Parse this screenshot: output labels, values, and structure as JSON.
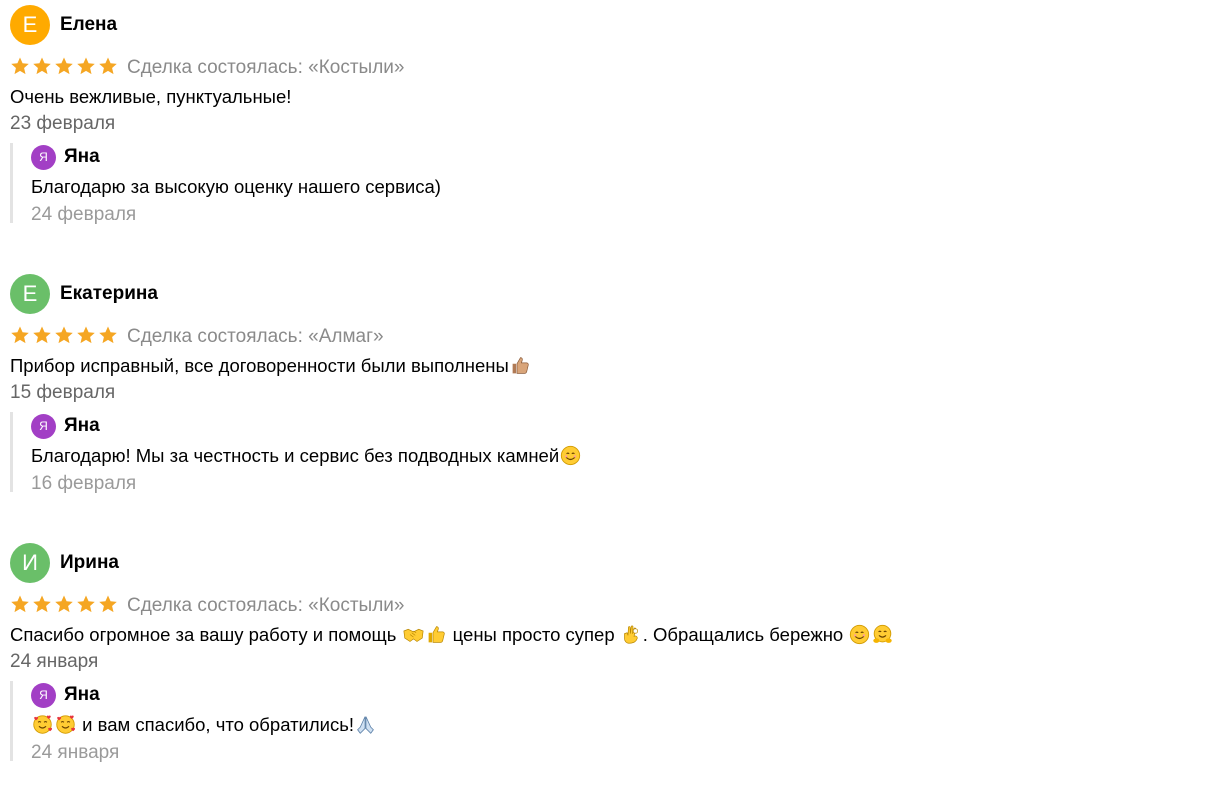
{
  "colors": {
    "star": "#f5a623",
    "avatar_orange": "#ffaa00",
    "avatar_green": "#6abf69",
    "reply_avatar": "#a23fc5"
  },
  "reviews": [
    {
      "author": "Елена",
      "initial": "Е",
      "rating": 5,
      "deal": "Сделка состоялась: «Костыли»",
      "text": "Очень вежливые, пунктуальные!",
      "date": "23 февраля",
      "reply": {
        "author": "Яна",
        "initial": "Я",
        "text": "Благодарю за высокую оценку нашего сервиса)",
        "date": "24 февраля"
      }
    },
    {
      "author": "Екатерина",
      "initial": "Е",
      "rating": 5,
      "deal": "Сделка состоялась: «Алмаг»",
      "text": "Прибор исправный, все договоренности были выполнены",
      "text_emoji": [
        "thumbs-up-emoji"
      ],
      "date": "15 февраля",
      "reply": {
        "author": "Яна",
        "initial": "Я",
        "text": "Благодарю! Мы за честность и сервис без подводных камней",
        "text_emoji": [
          "smiling-face-emoji"
        ],
        "date": "16 февраля"
      }
    },
    {
      "author": "Ирина",
      "initial": "И",
      "rating": 5,
      "deal": "Сделка состоялась: «Костыли»",
      "text_part1": "Спасибо огромное за вашу работу и помощь",
      "text_part2": "цены просто супер",
      "text_part3": ". Обращались бережно",
      "text_emoji": [
        "handshake-emoji",
        "thumbs-up-emoji",
        "ok-hand-emoji",
        "smiling-face-emoji",
        "hugging-face-emoji"
      ],
      "date": "24 января",
      "reply": {
        "author": "Яна",
        "initial": "Я",
        "text": "и вам спасибо, что обратились!",
        "text_emoji": [
          "smiling-face-with-hearts-emoji",
          "smiling-face-with-hearts-emoji",
          "folded-hands-emoji"
        ],
        "date": "24 января"
      }
    }
  ]
}
